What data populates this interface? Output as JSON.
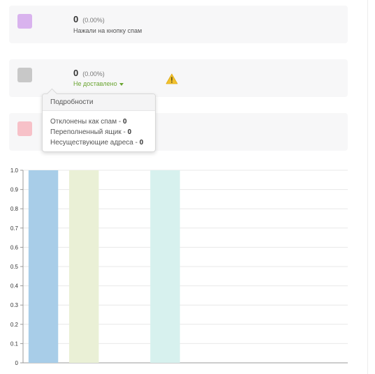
{
  "cards": [
    {
      "count": "0",
      "percent": "(0.00%)",
      "label": "Нажали на кнопку спам",
      "color": "#d9b3ee"
    },
    {
      "count": "0",
      "percent": "(0.00%)",
      "status_link": "Не доставлено",
      "color": "#c8c8c8",
      "warning_icon": "warning-triangle-icon"
    },
    {
      "color": "#f7c1c8"
    }
  ],
  "popover": {
    "title": "Подробности",
    "rows": [
      {
        "label": "Отклонены как спам - ",
        "value": "0"
      },
      {
        "label": "Переполненный ящик - ",
        "value": "0"
      },
      {
        "label": "Несуществующие адреса - ",
        "value": "0"
      }
    ]
  },
  "chart_data": {
    "type": "bar",
    "ylim": [
      0,
      1.0
    ],
    "y_ticks": [
      "1.0",
      "0.9",
      "0.8",
      "0.7",
      "0.6",
      "0.5",
      "0.4",
      "0.3",
      "0.2",
      "0.1",
      "0"
    ],
    "grid": true,
    "series": [
      {
        "values": [
          1.0
        ],
        "color": "#a8cde8"
      },
      {
        "values": [
          1.0
        ],
        "color": "#eaf0d6"
      },
      {
        "values": [
          1.0
        ],
        "color": "#d7f1ee"
      }
    ],
    "slots": [
      0,
      1,
      3
    ],
    "slot_count": 8
  }
}
